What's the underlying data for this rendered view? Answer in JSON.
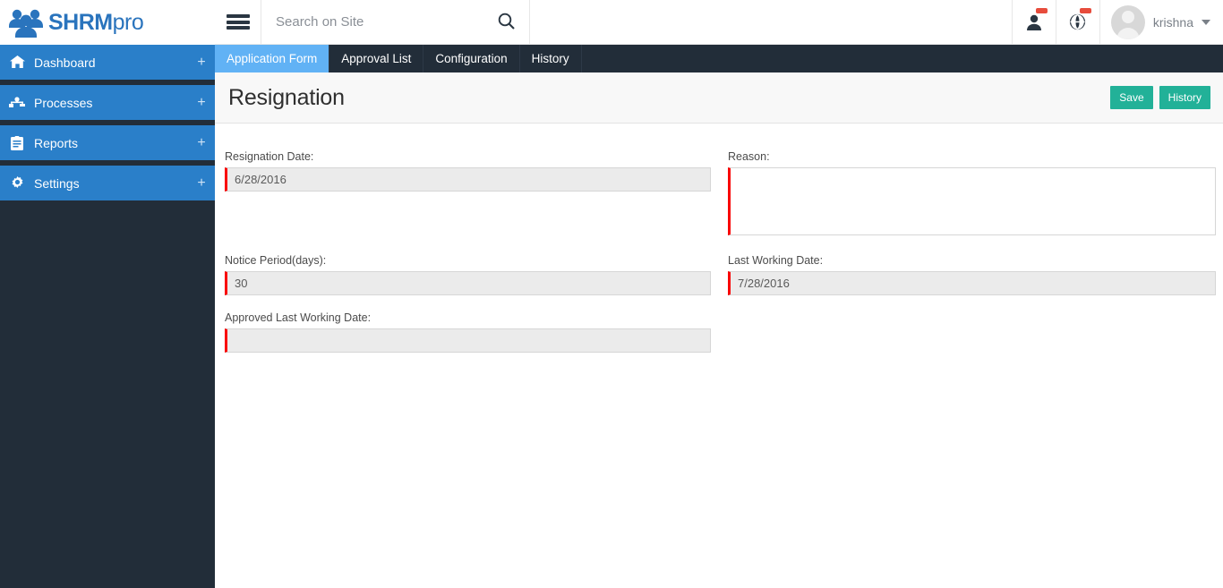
{
  "brand": {
    "name_main": "SHRM",
    "name_suffix": "pro",
    "logo_icon": "people-group-icon",
    "color": "#2a74bd"
  },
  "sidebar": {
    "bg_color": "#222d39",
    "item_color": "#2a7fc9",
    "items": [
      {
        "label": "Dashboard",
        "icon": "home-icon",
        "expand": "+"
      },
      {
        "label": "Processes",
        "icon": "sitemap-icon",
        "expand": "+"
      },
      {
        "label": "Reports",
        "icon": "clipboard-icon",
        "expand": "+"
      },
      {
        "label": "Settings",
        "icon": "gear-icon",
        "expand": "+"
      }
    ]
  },
  "topbar": {
    "menu_icon": "hamburger-icon",
    "search": {
      "placeholder": "Search on Site",
      "value": "",
      "icon": "search-icon"
    },
    "icons": [
      {
        "name": "user-icon",
        "badge": true
      },
      {
        "name": "globe-icon",
        "badge": true
      }
    ],
    "user": {
      "name": "krishna",
      "avatar_icon": "avatar-icon",
      "caret_icon": "chevron-down-icon"
    },
    "badge_color": "#e74c3c"
  },
  "tabs": [
    {
      "label": "Application Form",
      "active": true
    },
    {
      "label": "Approval List",
      "active": false
    },
    {
      "label": "Configuration",
      "active": false
    },
    {
      "label": "History",
      "active": false
    }
  ],
  "tab_active_color": "#61b2f5",
  "page": {
    "title": "Resignation",
    "actions": [
      {
        "label": "Save",
        "color": "#22b198"
      },
      {
        "label": "History",
        "color": "#22b198"
      }
    ]
  },
  "form": {
    "required_marker_color": "#f90000",
    "fields": [
      {
        "label": "Resignation Date:",
        "value": "6/28/2016",
        "type": "text",
        "readonly": true
      },
      {
        "label": "Reason:",
        "value": "",
        "type": "textarea",
        "readonly": false
      },
      {
        "label": "Notice Period(days):",
        "value": "30",
        "type": "text",
        "readonly": true
      },
      {
        "label": "Last Working Date:",
        "value": "7/28/2016",
        "type": "text",
        "readonly": true
      },
      {
        "label": "Approved Last Working Date:",
        "value": "",
        "type": "text",
        "readonly": true
      }
    ]
  }
}
